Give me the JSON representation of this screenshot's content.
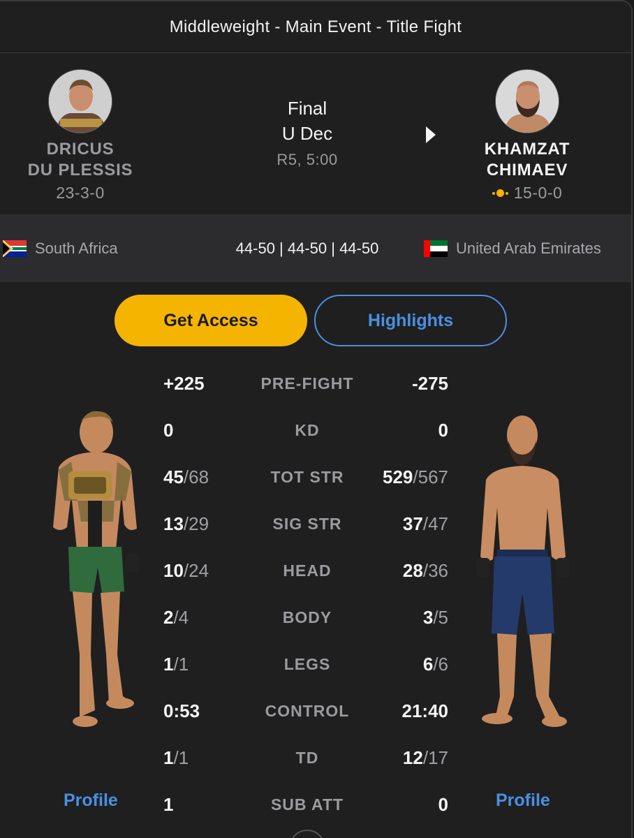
{
  "header": {
    "title": "Middleweight - Main Event - Title Fight"
  },
  "fighters": {
    "left": {
      "first_name": "DRICUS",
      "last_name": "DU PLESSIS",
      "record": "23-3-0",
      "country": "South Africa",
      "flag": "south-africa-flag"
    },
    "right": {
      "first_name": "KHAMZAT",
      "last_name": "CHIMAEV",
      "record": "15-0-0",
      "country": "United Arab Emirates",
      "flag": "uae-flag",
      "champion_icon": "champion-sun-icon"
    }
  },
  "result": {
    "status": "Final",
    "method": "U Dec",
    "round_time": "R5, 5:00",
    "scores": "44-50 | 44-50 | 44-50"
  },
  "buttons": {
    "access": "Get Access",
    "highlights": "Highlights"
  },
  "stats": [
    {
      "label": "PRE-FIGHT",
      "left": "+225",
      "left_total": "",
      "right": "-275",
      "right_total": ""
    },
    {
      "label": "KD",
      "left": "0",
      "left_total": "",
      "right": "0",
      "right_total": ""
    },
    {
      "label": "TOT STR",
      "left": "45",
      "left_total": "/68",
      "right": "529",
      "right_total": "/567"
    },
    {
      "label": "SIG STR",
      "left": "13",
      "left_total": "/29",
      "right": "37",
      "right_total": "/47"
    },
    {
      "label": "HEAD",
      "left": "10",
      "left_total": "/24",
      "right": "28",
      "right_total": "/36"
    },
    {
      "label": "BODY",
      "left": "2",
      "left_total": "/4",
      "right": "3",
      "right_total": "/5"
    },
    {
      "label": "LEGS",
      "left": "1",
      "left_total": "/1",
      "right": "6",
      "right_total": "/6"
    },
    {
      "label": "CONTROL",
      "left": "0:53",
      "left_total": "",
      "right": "21:40",
      "right_total": ""
    },
    {
      "label": "TD",
      "left": "1",
      "left_total": "/1",
      "right": "12",
      "right_total": "/17"
    },
    {
      "label": "SUB ATT",
      "left": "1",
      "left_total": "",
      "right": "0",
      "right_total": ""
    }
  ],
  "profile_links": {
    "left": "Profile",
    "right": "Profile"
  },
  "colors": {
    "accent_yellow": "#f5b400",
    "link_blue": "#4a90e2",
    "background": "#1f1f20",
    "band": "#2c2c2e"
  }
}
